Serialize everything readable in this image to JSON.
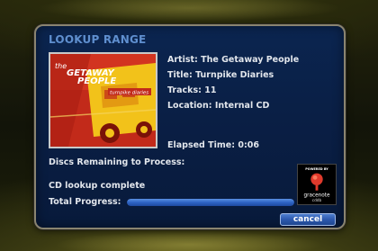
{
  "dialog": {
    "title": "LOOKUP RANGE",
    "album": {
      "artist": "Artist: The Getaway People",
      "title": "Title: Turnpike Diaries",
      "tracks": "Tracks: 11",
      "location": "Location: Internal CD",
      "elapsed": "Elapsed Time: 0:06",
      "cover_text": {
        "line1": "the",
        "line2": "GETAWAY",
        "line3": "PEOPLE",
        "tag": "turnpike diaries"
      }
    },
    "discs_remaining_label": "Discs Remaining to Process:",
    "status": "CD lookup complete",
    "total_progress_label": "Total Progress:",
    "total_progress": 1.0,
    "logo": {
      "powered_by": "POWERED BY",
      "brand": "gracenote",
      "sub": "cddb"
    },
    "cancel_label": "cancel"
  },
  "colors": {
    "dialog_bg": "#0a1f45",
    "title": "#5f8fcf",
    "text": "#e2e6ec",
    "progress": "#2d63c4",
    "button": "#2c58ad",
    "cover_red": "#c22a1a",
    "cover_yellow": "#f2c21a"
  }
}
